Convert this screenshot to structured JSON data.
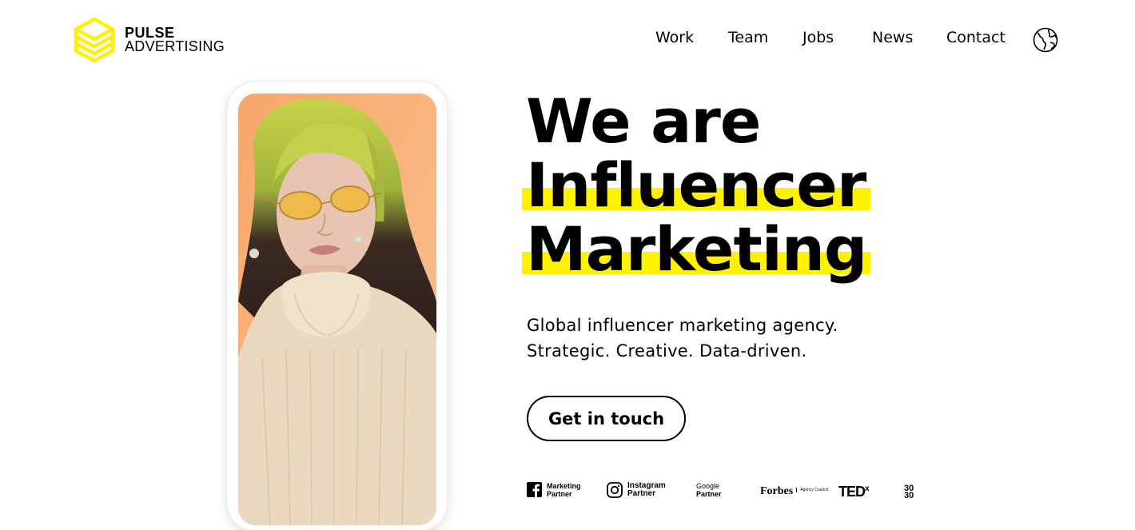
{
  "brand": {
    "name_line1": "PULSE",
    "name_line2": "ADVERTISING",
    "accent_color": "#fff200"
  },
  "nav": {
    "items": [
      {
        "label": "Work"
      },
      {
        "label": "Team"
      },
      {
        "label": "Jobs"
      },
      {
        "label": "News"
      },
      {
        "label": "Contact"
      }
    ],
    "language_icon": "globe-icon"
  },
  "hero": {
    "headline_line1": "We are",
    "headline_line2": "Influencer",
    "headline_line3": "Marketing",
    "subtitle_line1": "Global influencer marketing agency.",
    "subtitle_line2": "Strategic. Creative. Data-driven.",
    "cta_label": "Get in touch",
    "phone_image": "portrait of woman with green-yellow hair, orange sunglasses and beige turtleneck on orange background"
  },
  "partners": [
    {
      "icon": "facebook-icon",
      "line1": "Marketing",
      "line2": "Partner"
    },
    {
      "icon": "instagram-icon",
      "line1": "Instagram",
      "line2": "Partner"
    },
    {
      "icon": "",
      "line1": "Google",
      "line2": "Partner"
    },
    {
      "icon": "",
      "line1": "Forbes",
      "line2": "Agency Council"
    },
    {
      "icon": "",
      "line1": "TED",
      "line2": "x"
    },
    {
      "icon": "",
      "line1": "30",
      "line2": "30"
    }
  ]
}
